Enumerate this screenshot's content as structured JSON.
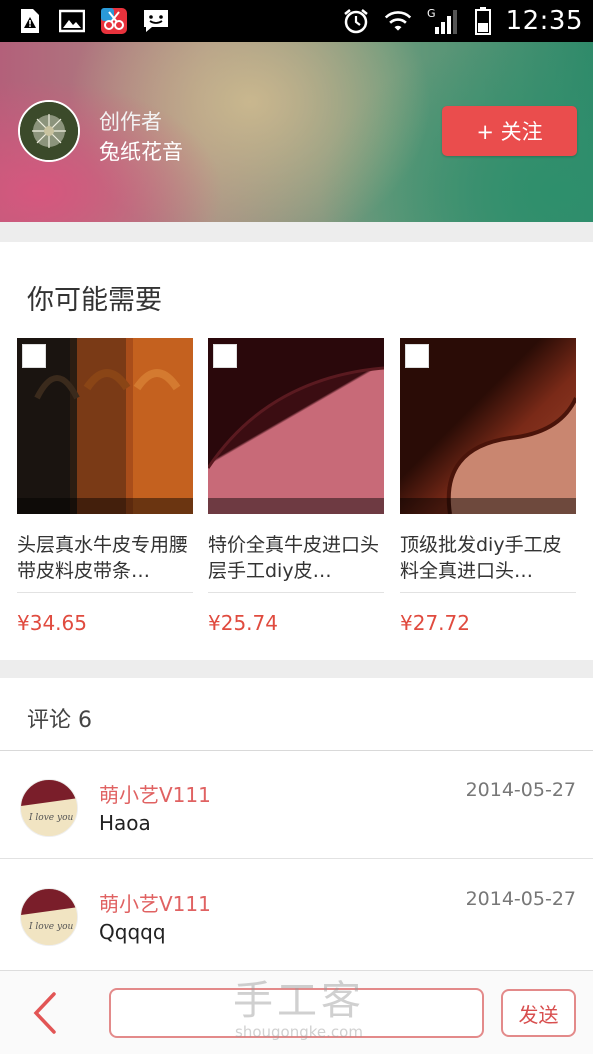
{
  "status_bar": {
    "time": "12:35",
    "network": "G"
  },
  "creator": {
    "label": "创作者",
    "name": "兔纸花音",
    "follow_label": "+ 关注"
  },
  "recommend": {
    "title": "你可能需要",
    "products": [
      {
        "name": "头层真水牛皮专用腰带皮料皮带条…",
        "price": "¥34.65"
      },
      {
        "name": "特价全真牛皮进口头层手工diy皮…",
        "price": "¥25.74"
      },
      {
        "name": "顶级批发diy手工皮料全真进口头…",
        "price": "¥27.72"
      }
    ]
  },
  "comments": {
    "title": "评论 6",
    "items": [
      {
        "user": "萌小艺V111",
        "date": "2014-05-27",
        "text": "Haoa"
      },
      {
        "user": "萌小艺V111",
        "date": "2014-05-27",
        "text": "Qqqqq"
      }
    ]
  },
  "bottom_bar": {
    "send_label": "发送",
    "input_placeholder": ""
  },
  "watermark": {
    "title": "手工客",
    "domain": "shougongke.com"
  },
  "colors": {
    "accent": "#ea4d4d",
    "price": "#e04b3f",
    "username": "#e06262"
  }
}
